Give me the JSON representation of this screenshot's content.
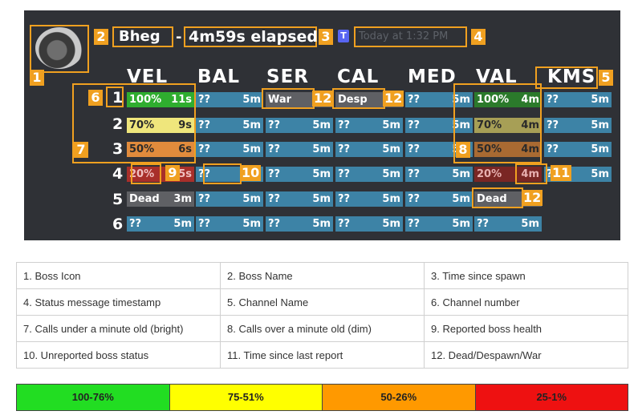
{
  "header": {
    "boss_name": "Bheg",
    "separator": "-",
    "elapsed": "4m59s elapsed",
    "badge": "T",
    "timestamp": "Today at 1:32 PM"
  },
  "channels": [
    "VEL",
    "BAL",
    "SER",
    "CAL",
    "MED",
    "VAL",
    "KMS"
  ],
  "row_numbers": [
    "1",
    "2",
    "3",
    "4",
    "5",
    "6"
  ],
  "grid": {
    "VEL": [
      {
        "state": "green",
        "left": "100%",
        "right": "11s"
      },
      {
        "state": "yellow",
        "left": "70%",
        "right": "9s"
      },
      {
        "state": "orange",
        "left": "50%",
        "right": "6s"
      },
      {
        "state": "red",
        "left": "20%",
        "right": "5s"
      },
      {
        "state": "grey",
        "left": "Dead",
        "right": "3m"
      },
      {
        "state": "unk",
        "left": "??",
        "right": "5m"
      }
    ],
    "BAL": [
      {
        "state": "unk",
        "left": "??",
        "right": "5m"
      },
      {
        "state": "unk",
        "left": "??",
        "right": "5m"
      },
      {
        "state": "unk",
        "left": "??",
        "right": "5m"
      },
      {
        "state": "unk",
        "left": "??",
        "right": "5m"
      },
      {
        "state": "unk",
        "left": "??",
        "right": "5m"
      },
      {
        "state": "unk",
        "left": "??",
        "right": "5m"
      }
    ],
    "SER": [
      {
        "state": "grey",
        "left": "War",
        "right": ""
      },
      {
        "state": "unk",
        "left": "??",
        "right": "5m"
      },
      {
        "state": "unk",
        "left": "??",
        "right": "5m"
      },
      {
        "state": "unk",
        "left": "??",
        "right": "5m"
      },
      {
        "state": "unk",
        "left": "??",
        "right": "5m"
      },
      {
        "state": "unk",
        "left": "??",
        "right": "5m"
      }
    ],
    "CAL": [
      {
        "state": "grey",
        "left": "Desp",
        "right": ""
      },
      {
        "state": "unk",
        "left": "??",
        "right": "5m"
      },
      {
        "state": "unk",
        "left": "??",
        "right": "5m"
      },
      {
        "state": "unk",
        "left": "??",
        "right": "5m"
      },
      {
        "state": "unk",
        "left": "??",
        "right": "5m"
      },
      {
        "state": "unk",
        "left": "??",
        "right": "5m"
      }
    ],
    "MED": [
      {
        "state": "unk",
        "left": "??",
        "right": "5m"
      },
      {
        "state": "unk",
        "left": "??",
        "right": "5m"
      },
      {
        "state": "unk",
        "left": "??",
        "right": "5m"
      },
      {
        "state": "unk",
        "left": "??",
        "right": "5m"
      },
      {
        "state": "unk",
        "left": "??",
        "right": "5m"
      },
      {
        "state": "unk",
        "left": "??",
        "right": "5m"
      }
    ],
    "VAL": [
      {
        "state": "green-d",
        "left": "100%",
        "right": "4m"
      },
      {
        "state": "yellow-d",
        "left": "70%",
        "right": "4m"
      },
      {
        "state": "orange-d",
        "left": "50%",
        "right": "4m"
      },
      {
        "state": "red-d",
        "left": "20%",
        "right": "4m"
      },
      {
        "state": "grey",
        "left": "Dead",
        "right": ""
      },
      {
        "state": "unk",
        "left": "??",
        "right": "5m"
      }
    ],
    "KMS": [
      {
        "state": "unk",
        "left": "??",
        "right": "5m"
      },
      {
        "state": "unk",
        "left": "??",
        "right": "5m"
      },
      {
        "state": "unk",
        "left": "??",
        "right": "5m"
      },
      {
        "state": "unk",
        "left": "??",
        "right": "5m"
      }
    ]
  },
  "markers": {
    "m1": "1",
    "m2": "2",
    "m3": "3",
    "m4": "4",
    "m5": "5",
    "m6": "6",
    "m7": "7",
    "m8": "8",
    "m9": "9",
    "m10": "10",
    "m11": "11",
    "m12": "12"
  },
  "legend": [
    [
      "1.  Boss Icon",
      "2. Boss Name",
      "3. Time since spawn"
    ],
    [
      "4. Status message timestamp",
      "5. Channel Name",
      "6. Channel number"
    ],
    [
      "7. Calls under a minute old (bright)",
      "8. Calls over a minute old (dim)",
      "9. Reported boss health"
    ],
    [
      "10. Unreported boss status",
      "11. Time since last report",
      "12. Dead/Despawn/War"
    ]
  ],
  "scale": [
    {
      "label": "100-76%",
      "color": "#22dd22"
    },
    {
      "label": "75-51%",
      "color": "#ffff00"
    },
    {
      "label": "50-26%",
      "color": "#ff9900"
    },
    {
      "label": "25-1%",
      "color": "#ee1111"
    }
  ]
}
